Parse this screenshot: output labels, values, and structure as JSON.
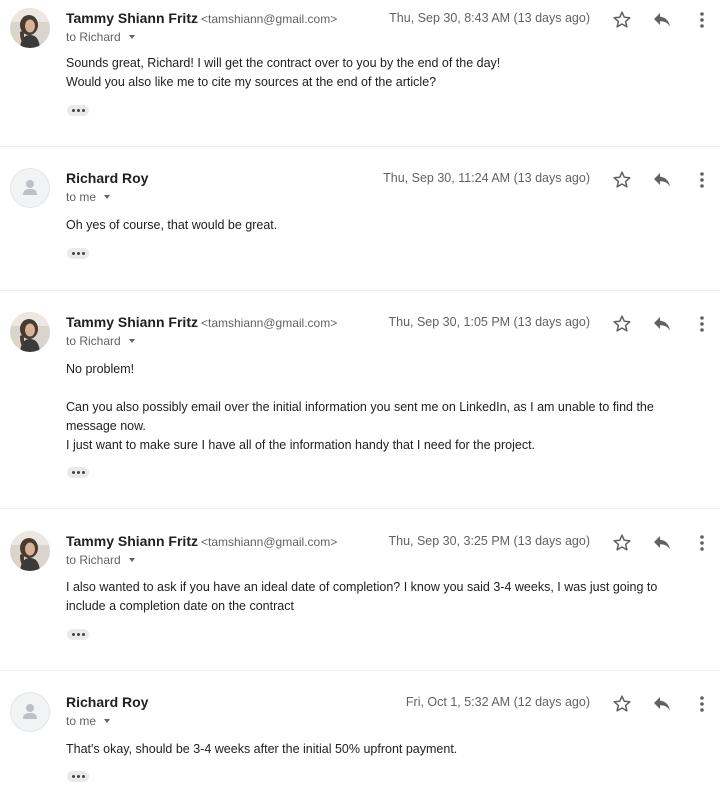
{
  "messages": [
    {
      "sender_name": "Tammy Shiann Fritz",
      "sender_email": "<tamshiann@gmail.com>",
      "recipient": "to Richard",
      "date": "Thu, Sep 30, 8:43 AM (13 days ago)",
      "avatar": "photo",
      "paragraphs": [
        "Sounds great, Richard! I will get the contract over to you by the end of the day!",
        "Would you also like me to cite my sources at the end of the article?"
      ]
    },
    {
      "sender_name": "Richard Roy",
      "sender_email": "",
      "recipient": "to me",
      "date": "Thu, Sep 30, 11:24 AM (13 days ago)",
      "avatar": "generic",
      "paragraphs": [
        "Oh yes of course, that would be great."
      ]
    },
    {
      "sender_name": "Tammy Shiann Fritz",
      "sender_email": "<tamshiann@gmail.com>",
      "recipient": "to Richard",
      "date": "Thu, Sep 30, 1:05 PM (13 days ago)",
      "avatar": "photo",
      "paragraphs": [
        "No problem!",
        "",
        "Can you also possibly email over the initial information you sent me on LinkedIn, as I am unable to find the message now.",
        "I just want to make sure I have all of the information handy that I need for the project."
      ]
    },
    {
      "sender_name": "Tammy Shiann Fritz",
      "sender_email": "<tamshiann@gmail.com>",
      "recipient": "to Richard",
      "date": "Thu, Sep 30, 3:25 PM (13 days ago)",
      "avatar": "photo",
      "paragraphs": [
        "I also wanted to ask if you have an ideal date of completion? I know you said 3-4 weeks, I was just going to include a completion date on the contract"
      ]
    },
    {
      "sender_name": "Richard Roy",
      "sender_email": "",
      "recipient": "to me",
      "date": "Fri, Oct 1, 5:32 AM (12 days ago)",
      "avatar": "generic",
      "paragraphs": [
        "That's okay, should be 3-4 weeks after the initial 50% upfront payment."
      ]
    }
  ],
  "icons": {
    "star": "star-icon",
    "reply": "reply-icon",
    "more": "more-vert-icon",
    "caret": "chevron-down-icon",
    "show_trimmed": "show-trimmed-content-icon"
  },
  "colors": {
    "text": "#202124",
    "secondary_text": "#5f6368",
    "divider": "#eceff1",
    "ellipsis_bg": "#e8eaed"
  }
}
